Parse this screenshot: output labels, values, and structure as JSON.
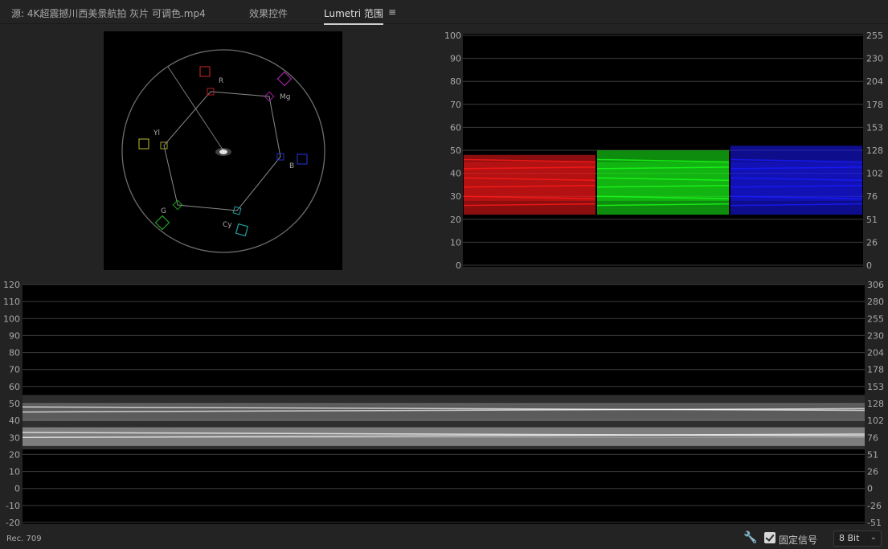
{
  "tabs": {
    "source": "源: 4K超震撼川西美景航拍 灰片 可调色.mp4",
    "effects": "效果控件",
    "lumetri": "Lumetri 范围",
    "menu_icon": "hamburger-menu-icon"
  },
  "vectorscope": {
    "labels": {
      "r": "R",
      "mg": "Mg",
      "b": "B",
      "cy": "Cy",
      "g": "G",
      "yl": "Yl"
    },
    "colors": {
      "r": "#b02020",
      "mg": "#a020a0",
      "b": "#2030c0",
      "cy": "#20a0a0",
      "g": "#20a020",
      "yl": "#a0a020"
    }
  },
  "parade": {
    "left_scale": [
      "100",
      "90",
      "80",
      "70",
      "60",
      "50",
      "40",
      "30",
      "20",
      "10",
      "0"
    ],
    "right_scale": [
      "255",
      "230",
      "204",
      "178",
      "153",
      "128",
      "102",
      "76",
      "51",
      "26",
      "0"
    ],
    "channels": [
      {
        "color": "#ff1a1a"
      },
      {
        "color": "#1aff1a"
      },
      {
        "color": "#1a1aff"
      }
    ]
  },
  "waveform": {
    "left_scale": [
      "120",
      "110",
      "100",
      "90",
      "80",
      "70",
      "60",
      "50",
      "40",
      "30",
      "20",
      "10",
      "0",
      "-10",
      "-20"
    ],
    "right_scale": [
      "306",
      "280",
      "255",
      "230",
      "204",
      "178",
      "153",
      "128",
      "102",
      "76",
      "51",
      "26",
      "0",
      "-26",
      "-51"
    ]
  },
  "footer": {
    "colorspace": "Rec. 709",
    "wrench_icon": "wrench-icon",
    "clamp_label": "固定信号",
    "clamp_checked": true,
    "bit_depth": "8 Bit"
  }
}
